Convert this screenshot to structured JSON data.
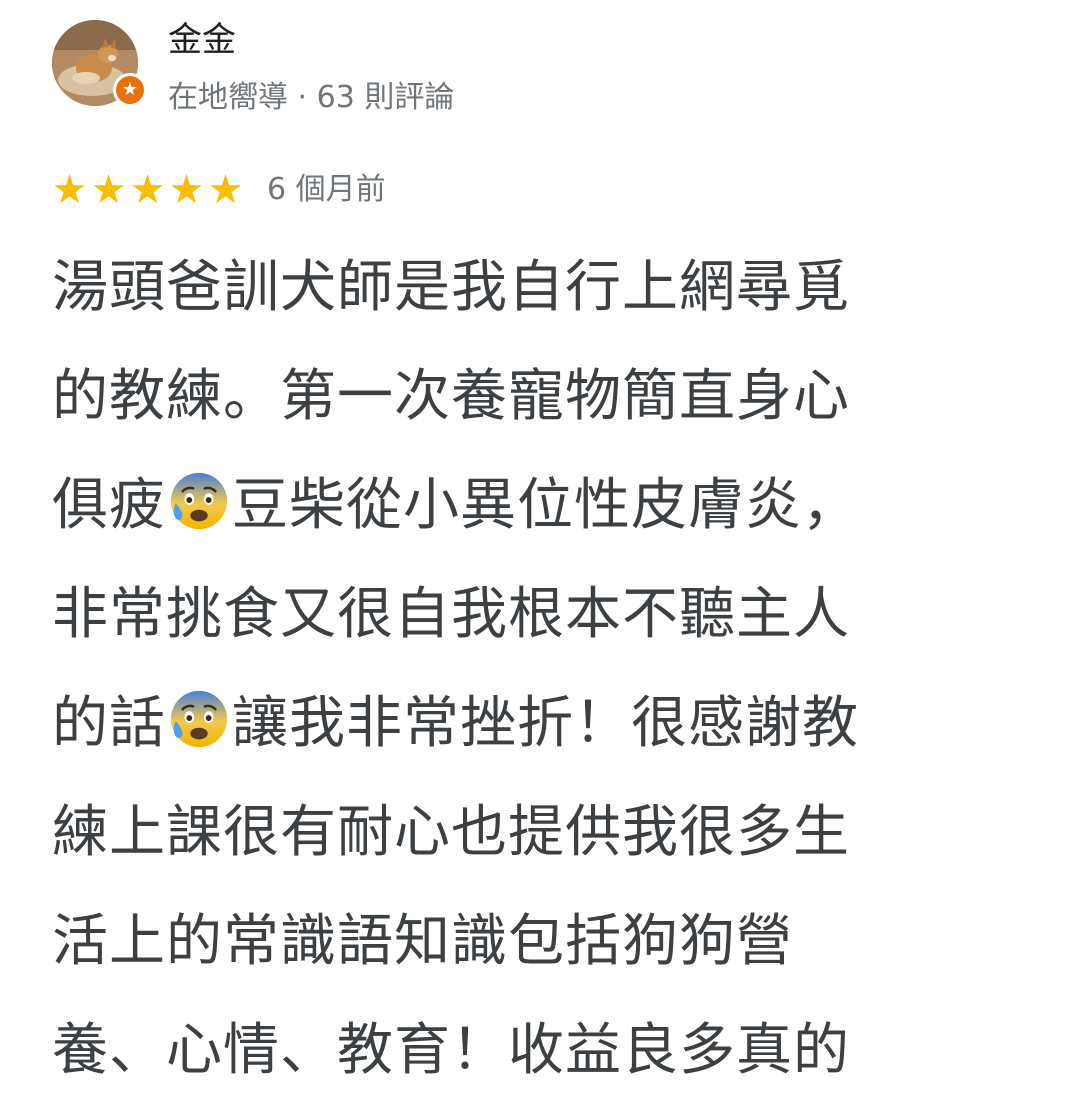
{
  "reviewer": {
    "name": "金金",
    "meta": "在地嚮導 · 63 則評論",
    "badge_icon": "star-icon",
    "badge_glyph": "★",
    "badge_color": "#e8710a"
  },
  "rating": {
    "stars": 5,
    "star_glyph": "★",
    "star_color": "#fbbc04",
    "date": "6 個月前"
  },
  "review": {
    "lines": [
      {
        "before": "湯頭爸訓犬師是我自行上網尋覓",
        "emoji": "",
        "after": ""
      },
      {
        "before": "的教練。第一次養寵物簡直身心",
        "emoji": "",
        "after": ""
      },
      {
        "before": "俱疲",
        "emoji": "anxious-face-with-sweat",
        "after": "豆柴從小異位性皮膚炎，"
      },
      {
        "before": "非常挑食又很自我根本不聽主人",
        "emoji": "",
        "after": ""
      },
      {
        "before": "的話",
        "emoji": "anxious-face-with-sweat",
        "after": "讓我非常挫折！很感謝教"
      },
      {
        "before": "練上課很有耐心也提供我很多生",
        "emoji": "",
        "after": ""
      },
      {
        "before": "活上的常識語知識包括狗狗營",
        "emoji": "",
        "after": ""
      },
      {
        "before": "養、心情、教育！收益良多真的",
        "emoji": "",
        "after": ""
      }
    ]
  }
}
